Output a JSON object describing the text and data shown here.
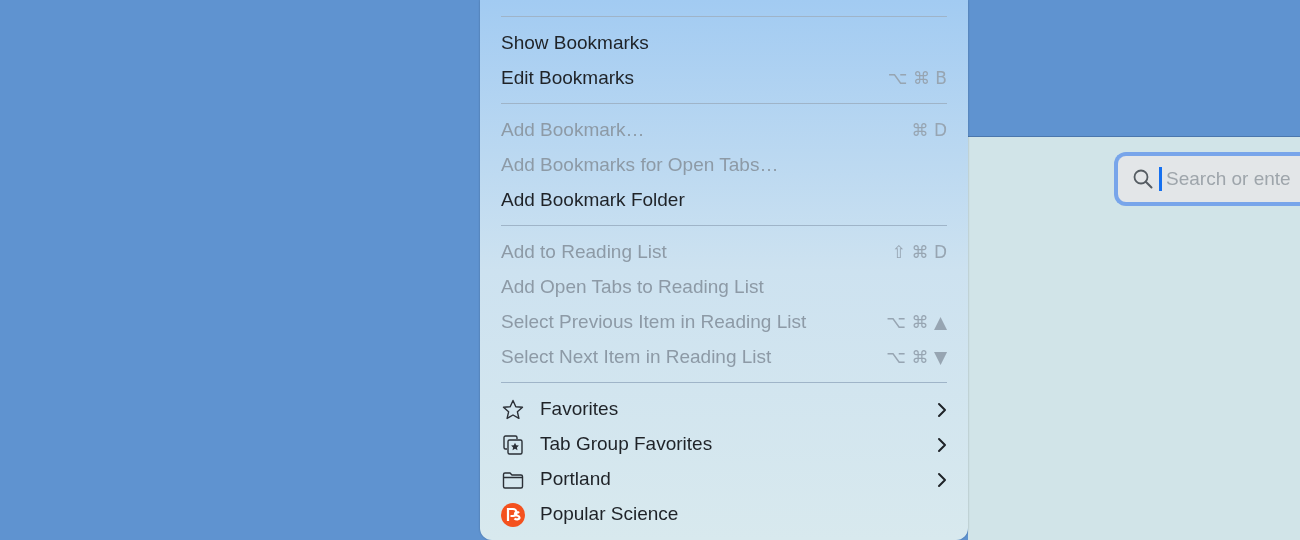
{
  "menu": {
    "sections": [
      {
        "items": [
          {
            "label": "Show Bookmarks",
            "disabled": false,
            "has_submenu": false,
            "kind": "plain"
          },
          {
            "label": "Edit Bookmarks",
            "shortcut": "⌥ ⌘ B",
            "disabled": false,
            "has_submenu": false,
            "kind": "plain"
          }
        ]
      },
      {
        "items": [
          {
            "label": "Add Bookmark…",
            "shortcut": "⌘ D",
            "disabled": true,
            "has_submenu": false,
            "kind": "plain"
          },
          {
            "label": "Add Bookmarks for Open Tabs…",
            "disabled": true,
            "has_submenu": false,
            "kind": "plain"
          },
          {
            "label": "Add Bookmark Folder",
            "disabled": false,
            "has_submenu": false,
            "kind": "plain"
          }
        ]
      },
      {
        "items": [
          {
            "label": "Add to Reading List",
            "shortcut": "⇧ ⌘ D",
            "disabled": true,
            "has_submenu": false,
            "kind": "plain"
          },
          {
            "label": "Add Open Tabs to Reading List",
            "disabled": true,
            "has_submenu": false,
            "kind": "plain"
          },
          {
            "label": "Select Previous Item in Reading List",
            "shortcut": "⌥ ⌘ ▲",
            "disabled": true,
            "has_submenu": false,
            "kind": "plain"
          },
          {
            "label": "Select Next Item in Reading List",
            "shortcut": "⌥ ⌘ ▼",
            "disabled": true,
            "has_submenu": false,
            "kind": "plain"
          }
        ]
      },
      {
        "items": [
          {
            "label": "Favorites",
            "disabled": false,
            "has_submenu": true,
            "kind": "star"
          },
          {
            "label": "Tab Group Favorites",
            "disabled": false,
            "has_submenu": true,
            "kind": "tab-group"
          },
          {
            "label": "Portland",
            "disabled": false,
            "has_submenu": true,
            "kind": "folder"
          },
          {
            "label": "Popular Science",
            "disabled": false,
            "has_submenu": false,
            "kind": "site"
          }
        ]
      }
    ]
  },
  "browser": {
    "address_field": {
      "placeholder": "Search or ente",
      "focused": true
    }
  }
}
